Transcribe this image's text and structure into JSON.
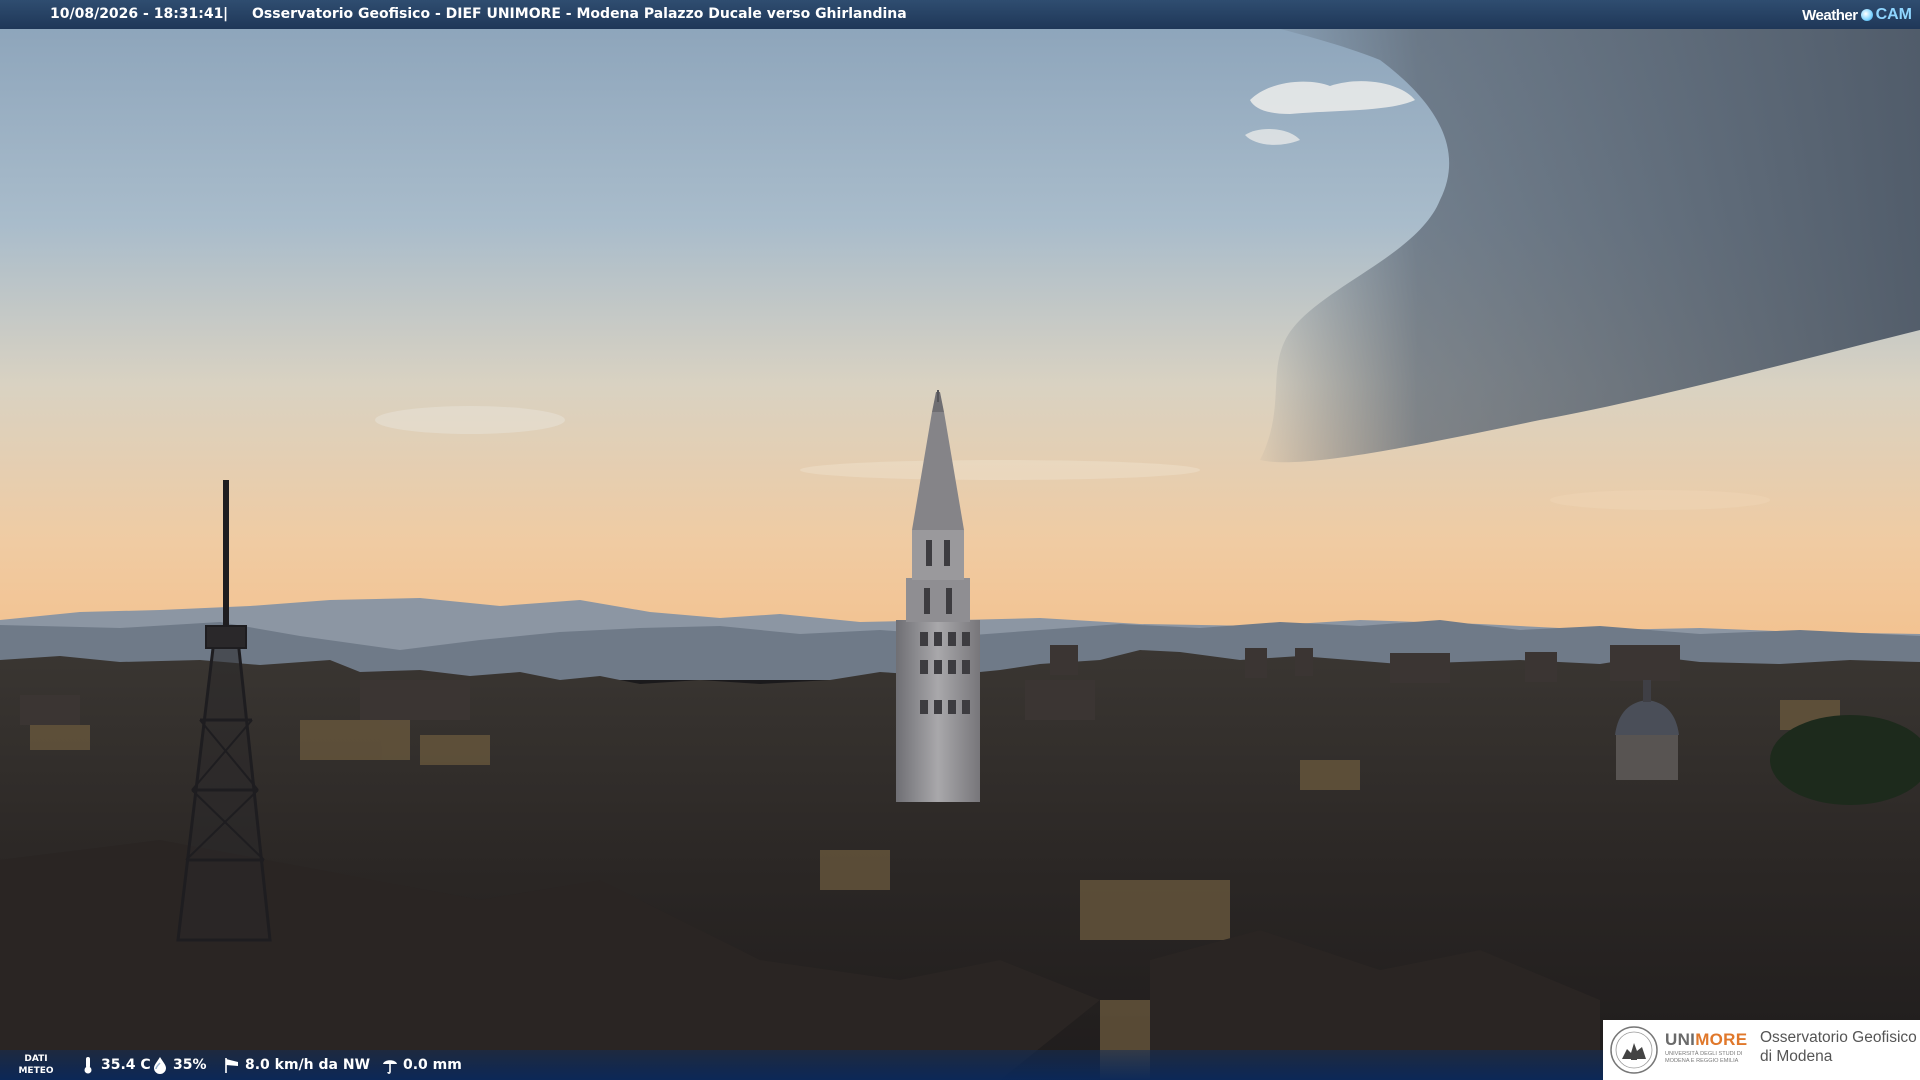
{
  "header": {
    "timestamp": "10/08/2026 - 18:31:41",
    "separator": "|",
    "location": "Osservatorio Geofisico - DIEF UNIMORE - Modena Palazzo Ducale verso Ghirlandina",
    "brand_weather": "Weather",
    "brand_cam": "CAM"
  },
  "weather": {
    "label_line1": "DATI",
    "label_line2": "METEO",
    "temperature": "35.4 C",
    "humidity": "35%",
    "wind": "8.0 km/h da NW",
    "rain": "0.0 mm",
    "icons": [
      "thermometer-icon",
      "humidity-drop-icon",
      "wind-sock-icon",
      "rain-gauge-icon"
    ]
  },
  "logo": {
    "uni": "UNI",
    "more": "MORE",
    "university": "UNIVERSITÀ DEGLI STUDI DI MODENA E REGGIO EMILIA",
    "observatory_line1": "Osservatorio Geofisico",
    "observatory_line2": "di Modena"
  },
  "colors": {
    "bar_blue": "#1f3758",
    "brand_accent": "#e0782b",
    "sky_top": "#8fa4b8",
    "sky_horizon": "#f2c79c"
  }
}
